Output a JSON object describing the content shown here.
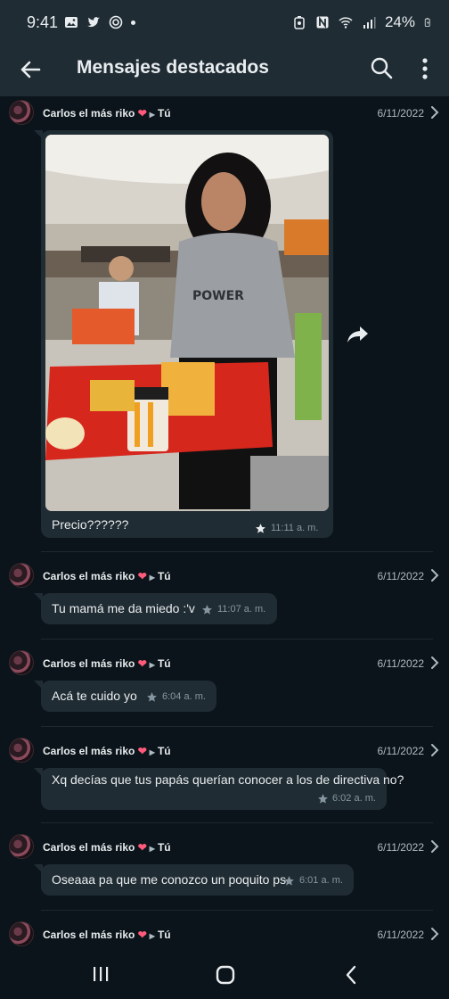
{
  "status_bar": {
    "time": "9:41",
    "battery": "24%"
  },
  "app_bar": {
    "title": "Mensajes destacados"
  },
  "messages": [
    {
      "sender": "Carlos el más riko",
      "recipient": "Tú",
      "date": "6/11/2022",
      "text": "Precio??????",
      "time": "11:11 a. m.",
      "has_image": true
    },
    {
      "sender": "Carlos el más riko",
      "recipient": "Tú",
      "date": "6/11/2022",
      "text": "Tu mamá me da miedo :'v",
      "time": "11:07 a. m."
    },
    {
      "sender": "Carlos el más riko",
      "recipient": "Tú",
      "date": "6/11/2022",
      "text": "Acá te cuido yo",
      "time": "6:04 a. m."
    },
    {
      "sender": "Carlos el más riko",
      "recipient": "Tú",
      "date": "6/11/2022",
      "text": "Xq decías que tus papás querían conocer a los de directiva no?",
      "time": "6:02 a. m."
    },
    {
      "sender": "Carlos el más riko",
      "recipient": "Tú",
      "date": "6/11/2022",
      "text": "Oseaaa pa que me conozco un poquito ps",
      "time": "6:01 a. m."
    },
    {
      "sender": "Carlos el más riko",
      "recipient": "Tú",
      "date": "6/11/2022"
    }
  ],
  "icons": {
    "back": "arrow-left-icon",
    "search": "search-icon",
    "menu": "more-vert-icon",
    "forward": "forward-icon",
    "star": "star-icon",
    "chevron": "chevron-right-icon"
  },
  "colors": {
    "background": "#0b141a",
    "header": "#1f2c34",
    "bubble": "#202c33",
    "text": "#e9edef",
    "muted": "#8696a0"
  }
}
